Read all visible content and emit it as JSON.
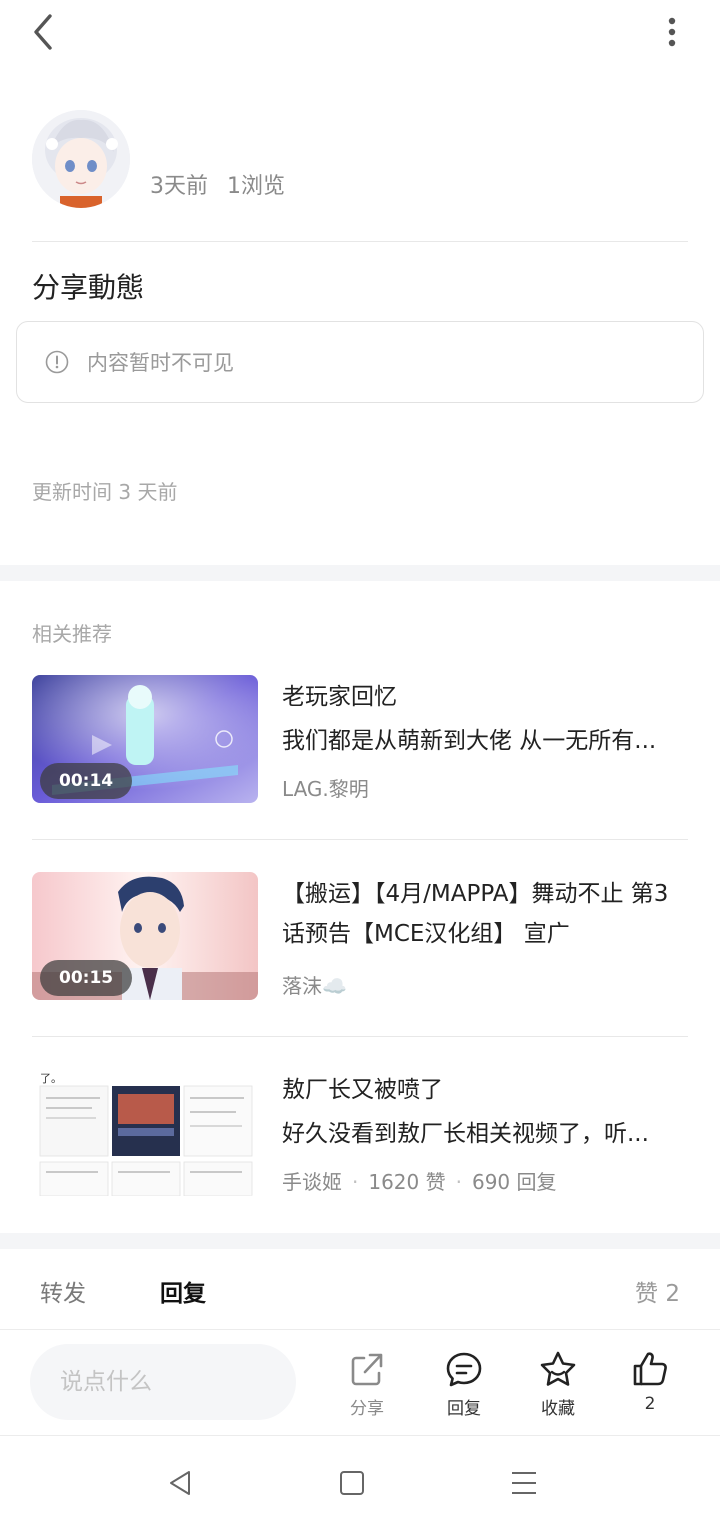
{
  "post": {
    "time_ago": "3天前",
    "views": "1浏览",
    "title": "分享動態",
    "notice": "内容暂时不可见",
    "updated": "更新时间 3 天前"
  },
  "related": {
    "header": "相关推荐",
    "items": [
      {
        "title": "老玩家回忆",
        "desc": "我们都是从萌新到大佬 从一无所有...",
        "author": "LAG.黎明",
        "duration": "00:14"
      },
      {
        "title": "【搬运】【4月/MAPPA】舞动不止 第3话预告【MCE汉化组】 宣广",
        "author": "落沫☁️",
        "duration": "00:15"
      },
      {
        "title": "敖厂长又被喷了",
        "desc": "好久没看到敖厂长相关视频了，听...",
        "author": "手谈姬",
        "likes": "1620 赞",
        "replies": "690 回复",
        "thumb_caption": "了。"
      }
    ]
  },
  "tabs": {
    "forward": "转发",
    "reply": "回复",
    "like": "赞 2"
  },
  "action_bar": {
    "input_placeholder": "说点什么",
    "share": "分享",
    "reply": "回复",
    "favorite": "收藏",
    "like_count": "2"
  },
  "icons": {
    "back": "back-arrow-icon",
    "more": "more-vertical-icon",
    "notice": "info-circle-icon",
    "share": "share-icon",
    "reply": "chat-bubble-icon",
    "favorite": "star-icon",
    "like": "thumbs-up-icon"
  },
  "colors": {
    "muted": "#8a8a8a",
    "band": "#f4f5f7",
    "input_bg": "#f5f6f8"
  }
}
